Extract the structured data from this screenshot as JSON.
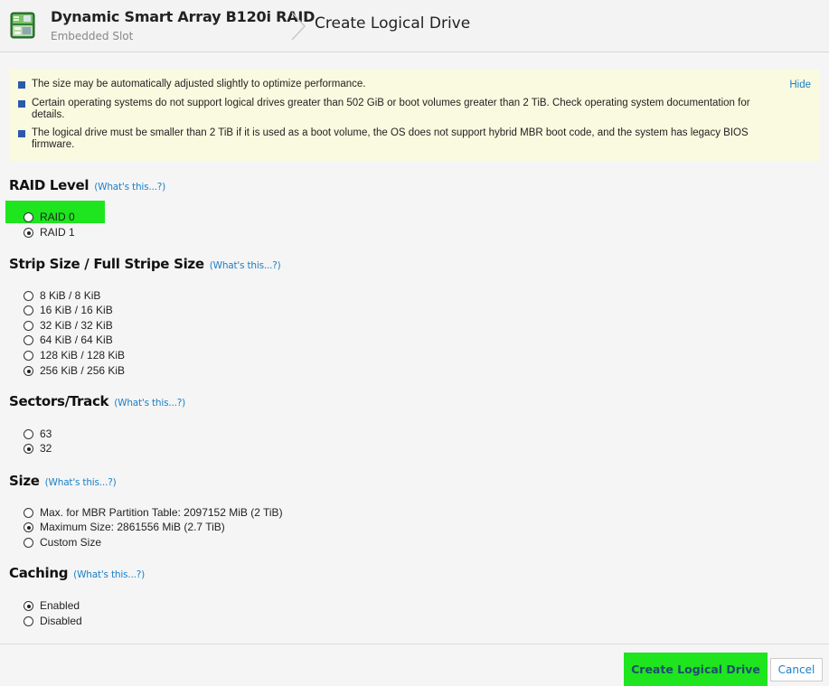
{
  "header": {
    "device_name": "Dynamic Smart Array B120i RAID",
    "device_location": "Embedded Slot",
    "page_title": "Create Logical Drive"
  },
  "notice": {
    "items": [
      "The size may be automatically adjusted slightly to optimize performance.",
      "Certain operating systems do not support logical drives greater than 502 GiB or boot volumes greater than 2 TiB. Check operating system documentation for details.",
      "The logical drive must be smaller than 2 TiB if it is used as a boot volume, the OS does not support hybrid MBR boot code, and the system has legacy BIOS firmware."
    ],
    "hide_label": "Hide"
  },
  "help_link": "(What's this...?)",
  "sections": {
    "raid_level": {
      "title": "RAID Level",
      "options": [
        "RAID 0",
        "RAID 1"
      ],
      "selected": "RAID 1"
    },
    "strip_size": {
      "title": "Strip Size / Full Stripe Size",
      "options": [
        "8 KiB / 8 KiB",
        "16 KiB / 16 KiB",
        "32 KiB / 32 KiB",
        "64 KiB / 64 KiB",
        "128 KiB / 128 KiB",
        "256 KiB / 256 KiB"
      ],
      "selected": "256 KiB / 256 KiB"
    },
    "sectors_track": {
      "title": "Sectors/Track",
      "options": [
        "63",
        "32"
      ],
      "selected": "32"
    },
    "size": {
      "title": "Size",
      "options": [
        "Max. for MBR Partition Table: 2097152 MiB (2 TiB)",
        "Maximum Size: 2861556 MiB (2.7 TiB)",
        "Custom Size"
      ],
      "selected": "Maximum Size: 2861556 MiB (2.7 TiB)"
    },
    "caching": {
      "title": "Caching",
      "options": [
        "Enabled",
        "Disabled"
      ],
      "selected": "Enabled"
    }
  },
  "footer": {
    "create_label": "Create Logical Drive",
    "cancel_label": "Cancel"
  },
  "colors": {
    "highlight": "#1ee51e",
    "link": "#1a80c8",
    "notice_bg": "#fafae0",
    "bullet": "#2a5aa8"
  },
  "icons": {
    "app": "array-controller-icon",
    "breadcrumb_separator": "chevron-right-icon",
    "notice_bullet": "square-bullet-icon"
  }
}
